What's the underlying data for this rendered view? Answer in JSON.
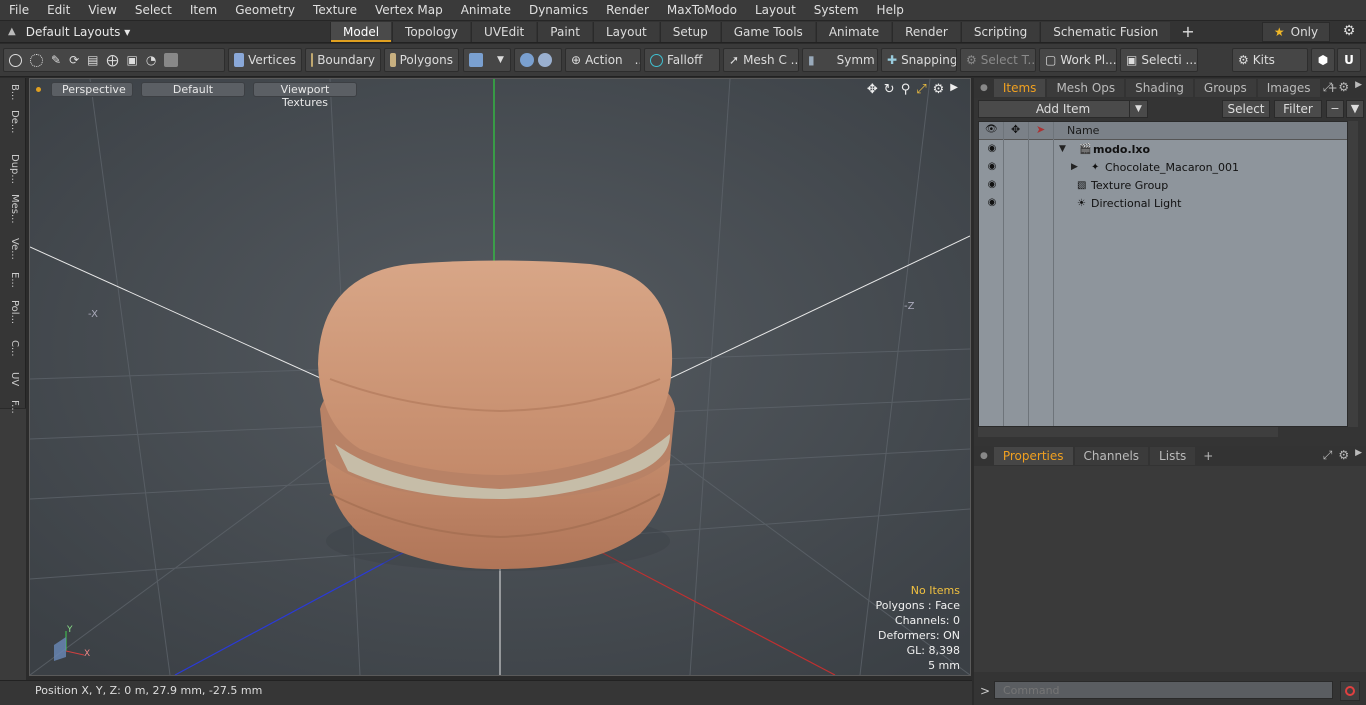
{
  "menu": [
    "File",
    "Edit",
    "View",
    "Select",
    "Item",
    "Geometry",
    "Texture",
    "Vertex Map",
    "Animate",
    "Dynamics",
    "Render",
    "MaxToModo",
    "Layout",
    "System",
    "Help"
  ],
  "layouts_label": "Default Layouts ▾",
  "tabs": [
    "Model",
    "Topology",
    "UVEdit",
    "Paint",
    "Layout",
    "Setup",
    "Game Tools",
    "Animate",
    "Render",
    "Scripting",
    "Schematic Fusion"
  ],
  "active_tab": "Model",
  "only_label": "Only",
  "toolbar": {
    "vertices": "Vertices",
    "boundary": "Boundary",
    "polygons": "Polygons",
    "action": "Action",
    "action_more": "...",
    "falloff": "Falloff",
    "mesh": "Mesh C ...",
    "symm": "Symm ...",
    "snapping": "Snapping",
    "select_t": "Select T...",
    "work_pl": "Work Pl...",
    "selecti": "Selecti ...",
    "kits": "Kits"
  },
  "left_tabs": [
    "B...",
    "De...",
    "Dup...",
    "Mes...",
    "Ve...",
    "E...",
    "Pol...",
    "C...",
    "UV",
    "F..."
  ],
  "viewport": {
    "view": "Perspective",
    "shading": "Default",
    "textures": "Viewport Textures",
    "axis_neg_x": "-X",
    "axis_neg_z": "-Z",
    "gizmo_y": "Y",
    "gizmo_x": "X",
    "info": {
      "no_items": "No Items",
      "polygons": "Polygons : Face",
      "channels": "Channels: 0",
      "deformers": "Deformers: ON",
      "gl": "GL: 8,398",
      "scale": "5 mm"
    }
  },
  "status": "Position X, Y, Z:   0 m, 27.9 mm, -27.5 mm",
  "items_panel": {
    "tabs": [
      "Items",
      "Mesh Ops",
      "Shading",
      "Groups",
      "Images"
    ],
    "add_item": "Add Item",
    "select": "Select",
    "filter": "Filter",
    "name_header": "Name",
    "rows": [
      {
        "label": "modo.lxo",
        "bold": true
      },
      {
        "label": "Chocolate_Macaron_001",
        "bold": false
      },
      {
        "label": "Texture Group",
        "bold": false
      },
      {
        "label": "Directional Light",
        "bold": false
      }
    ]
  },
  "props_panel": {
    "tabs": [
      "Properties",
      "Channels",
      "Lists"
    ]
  },
  "command_placeholder": "Command",
  "colors": {
    "accent": "#e0a020",
    "viewport_bg": "#4d5257",
    "macaron": "#c99474",
    "filling": "#b8b0a0"
  }
}
